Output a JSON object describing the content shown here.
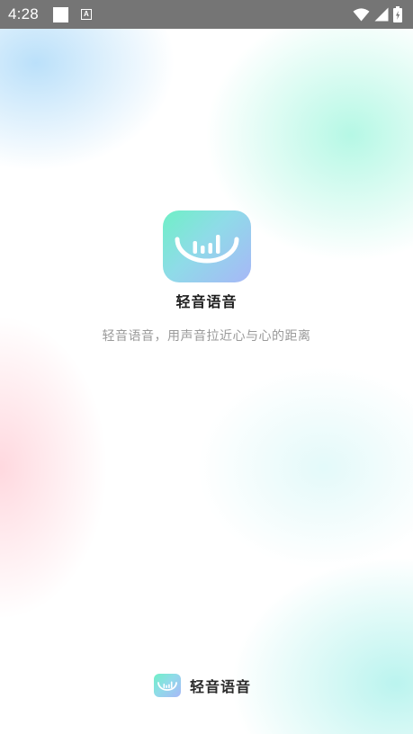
{
  "status_bar": {
    "time": "4:28",
    "notification_letter": "A",
    "icons": [
      "square-notification-icon",
      "a-badge-icon",
      "wifi-icon",
      "signal-icon",
      "battery-charging-icon"
    ]
  },
  "splash": {
    "app_name": "轻音语音",
    "slogan": "轻音语音，用声音拉近心与心的距离"
  },
  "footer": {
    "brand_name": "轻音语音"
  },
  "colors": {
    "status_bar": "#757575",
    "logo_gradient_start": "#6ff0c6",
    "logo_gradient_end": "#a7b7f7",
    "slogan_text": "#9a9a9a",
    "title_text": "#1e1e1e"
  }
}
